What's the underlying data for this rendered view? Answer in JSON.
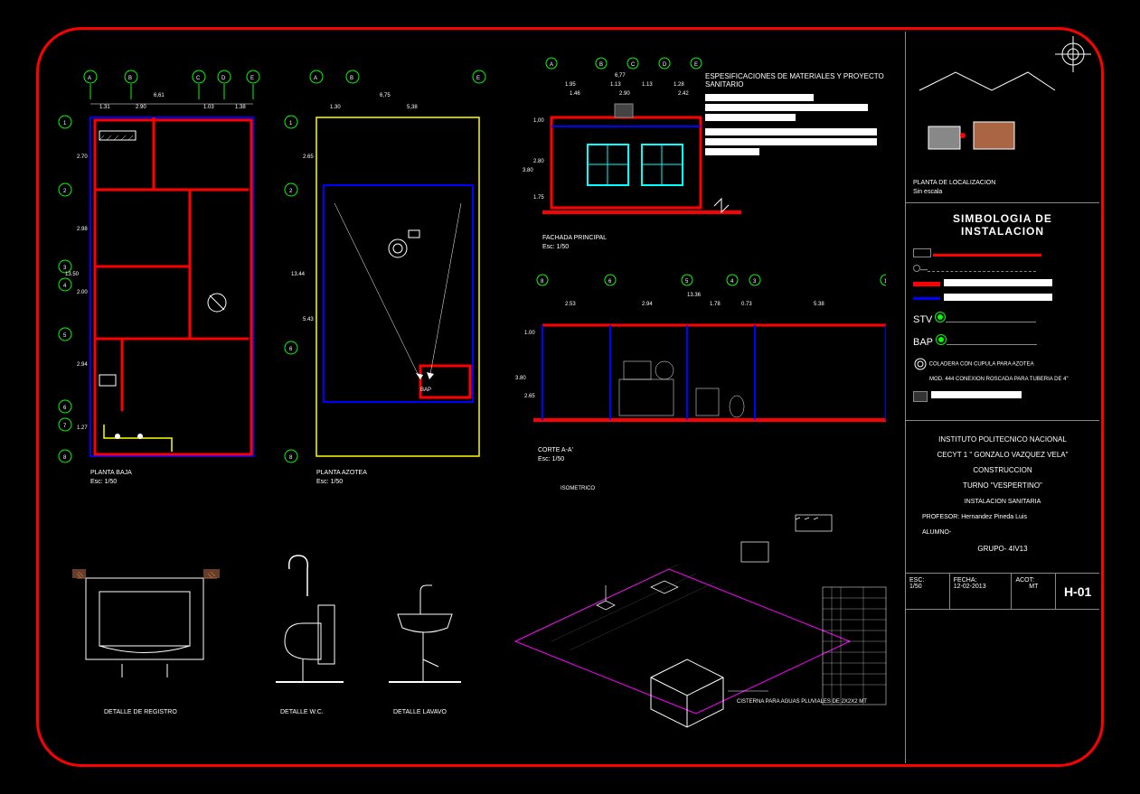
{
  "spec": {
    "title": "ESPESIFICACIONES DE MATERIALES Y PROYECTO SANITARIO"
  },
  "location": {
    "label": "PLANTA DE LOCALIZACION",
    "scale": "Sin escala"
  },
  "symbology": {
    "title": "SIMBOLOGIA DE INSTALACION",
    "stv": "STV",
    "bap": "BAP",
    "drain": "COLADERA CON CUPULA PARA AZOTEA",
    "conn": "MOD. 444 CONEXION ROSCADA PARA TUBERIA DE 4\""
  },
  "titleblock": {
    "inst": "INSTITUTO POLITECNICO NACIONAL",
    "school": "CECYT 1 \" GONZALO VAZQUEZ VELA\"",
    "course": "CONSTRUCCION",
    "shift": "TURNO \"VESPERTINO\"",
    "subject": "INSTALACION SANITARIA",
    "prof_label": "PROFESOR:",
    "prof": "Hernandez Pineda Luis",
    "student_label": "ALUMNO-",
    "group_label": "GRUPO-",
    "group": "4IV13",
    "esc_label": "ESC:",
    "esc": "1/50",
    "fecha_label": "FECHA:",
    "fecha": "12-02-2013",
    "acot_label": "ACOT:",
    "acot": "MT",
    "sheet": "H-01"
  },
  "views": {
    "planta_baja": {
      "label": "PLANTA BAJA",
      "scale": "Esc: 1/50"
    },
    "planta_azotea": {
      "label": "PLANTA AZOTEA",
      "scale": "Esc: 1/50"
    },
    "fachada": {
      "label": "FACHADA PRINCIPAL",
      "scale": "Esc: 1/50"
    },
    "corte": {
      "label": "CORTE A-A'",
      "scale": "Esc: 1/50"
    },
    "iso": {
      "label": "ISOMETRICO"
    },
    "detalle_reg": {
      "label": "DETALLE DE REGISTRO"
    },
    "detalle_wc": {
      "label": "DETALLE W.C."
    },
    "detalle_lav": {
      "label": "DETALLE LAVAVO"
    },
    "cisterna": {
      "label": "CISTERNA PARA AGUAS PLUVIALES DE 2X2X2 MT"
    }
  },
  "dims": {
    "pb_top": {
      "total": "6,61",
      "a": "1.31",
      "b": "2.90",
      "c": "1.03",
      "d": "1.38"
    },
    "pb_left": {
      "total": "13.50",
      "a": "2.70",
      "b": "2.98",
      "c": "2.00",
      "d": "2.94",
      "e": "1.27"
    },
    "az_top": {
      "total": "6,75",
      "a": "1.30",
      "b": "5,38"
    },
    "az_left": {
      "total": "13.44",
      "a": "2.65",
      "b": "5.43"
    },
    "fachada_top": {
      "total": "6,77",
      "a": "1.95",
      "b": "1.13",
      "c": "1.13",
      "d": "1.28",
      "e": "1.46",
      "f": "2.90",
      "g": "2.42"
    },
    "fachada_left": {
      "a": "1,00",
      "b": "2.80",
      "c": "3.80",
      "d": "1.75"
    },
    "corte_top": {
      "total": "13.36",
      "a": "2.53",
      "b": "2.94",
      "c": "1.78",
      "d": "0.73",
      "e": "5.38"
    },
    "corte_left": {
      "a": "1.00",
      "b": "3.80",
      "c": "2.65"
    }
  },
  "axes": {
    "letters": [
      "A",
      "B",
      "C",
      "D",
      "E"
    ],
    "numbers": [
      "1",
      "2",
      "3",
      "4",
      "5",
      "6",
      "7",
      "8"
    ]
  },
  "misc": {
    "bap": "BAP"
  }
}
